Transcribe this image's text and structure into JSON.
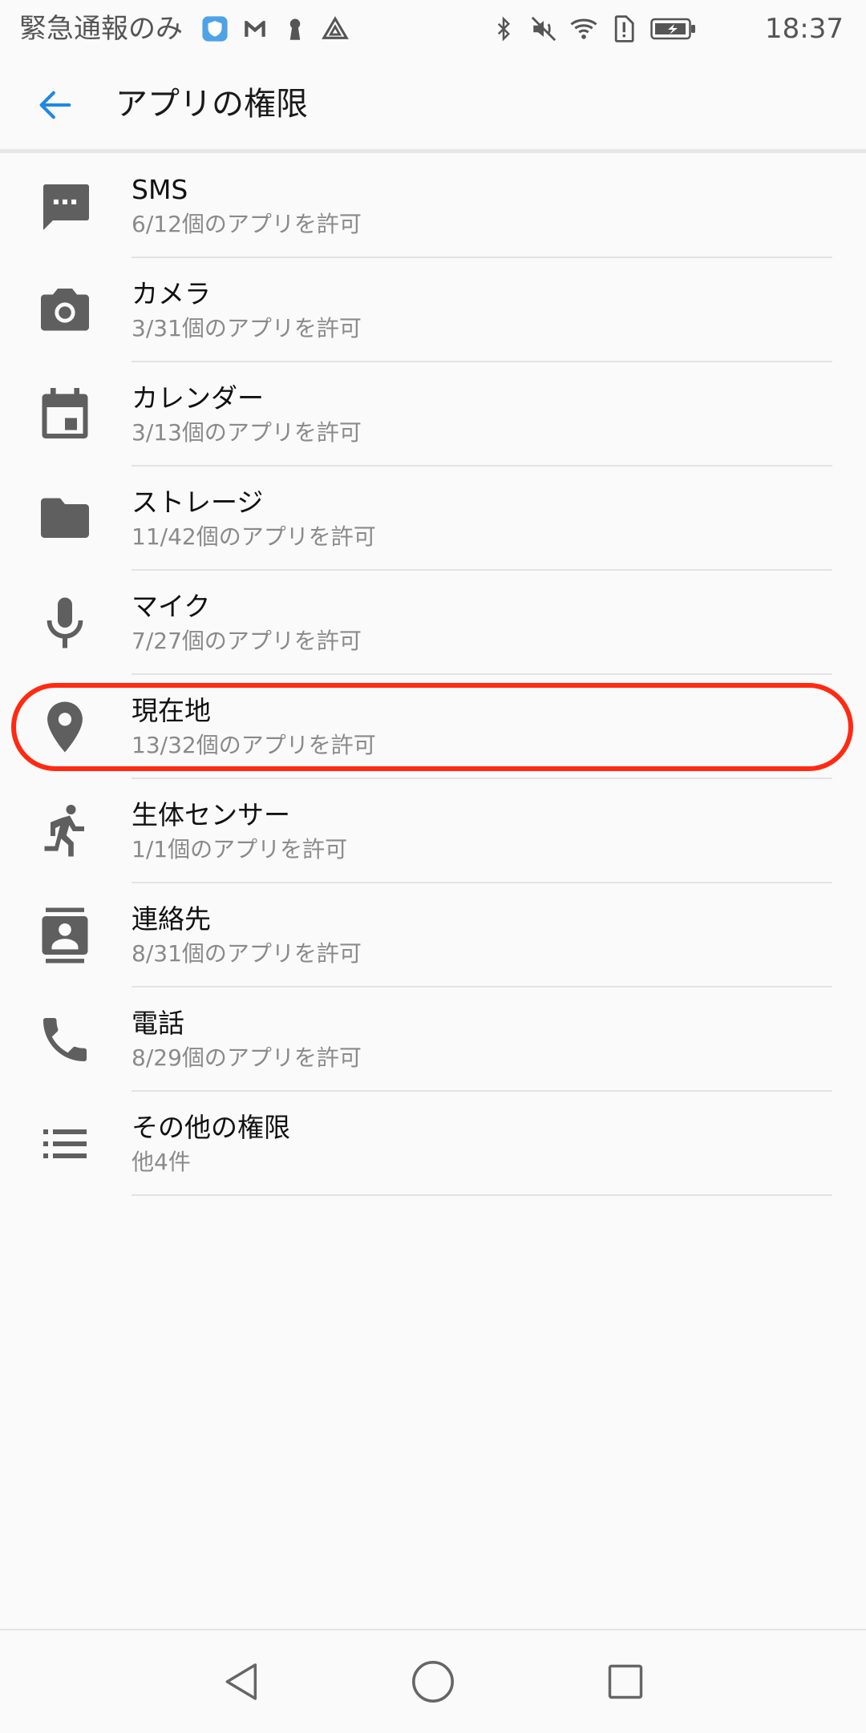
{
  "status_bar": {
    "carrier_text": "緊急通報のみ",
    "time": "18:37",
    "left_icons": [
      "shield-app-icon",
      "gmail-icon",
      "keyhole-icon",
      "drive-icon"
    ],
    "right_icons": [
      "bluetooth-icon",
      "mute-icon",
      "wifi-icon",
      "sim-alert-icon",
      "battery-charging-icon"
    ]
  },
  "app_bar": {
    "title": "アプリの権限"
  },
  "permissions": [
    {
      "label": "SMS",
      "detail": "6/12個のアプリを許可",
      "icon": "sms-icon"
    },
    {
      "label": "カメラ",
      "detail": "3/31個のアプリを許可",
      "icon": "camera-icon"
    },
    {
      "label": "カレンダー",
      "detail": "3/13個のアプリを許可",
      "icon": "calendar-icon"
    },
    {
      "label": "ストレージ",
      "detail": "11/42個のアプリを許可",
      "icon": "folder-icon"
    },
    {
      "label": "マイク",
      "detail": "7/27個のアプリを許可",
      "icon": "microphone-icon"
    },
    {
      "label": "現在地",
      "detail": "13/32個のアプリを許可",
      "icon": "location-pin-icon",
      "highlighted": true
    },
    {
      "label": "生体センサー",
      "detail": "1/1個のアプリを許可",
      "icon": "body-sensor-icon"
    },
    {
      "label": "連絡先",
      "detail": "8/31個のアプリを許可",
      "icon": "contacts-icon"
    },
    {
      "label": "電話",
      "detail": "8/29個のアプリを許可",
      "icon": "phone-icon"
    },
    {
      "label": "その他の権限",
      "detail": "他4件",
      "icon": "list-icon"
    }
  ],
  "colors": {
    "accent": "#1e88e5",
    "highlight_ring": "#ff2a12",
    "icon_gray": "#5f5f5f"
  },
  "nav_bar": [
    "back-triangle-icon",
    "home-circle-icon",
    "recents-square-icon"
  ]
}
